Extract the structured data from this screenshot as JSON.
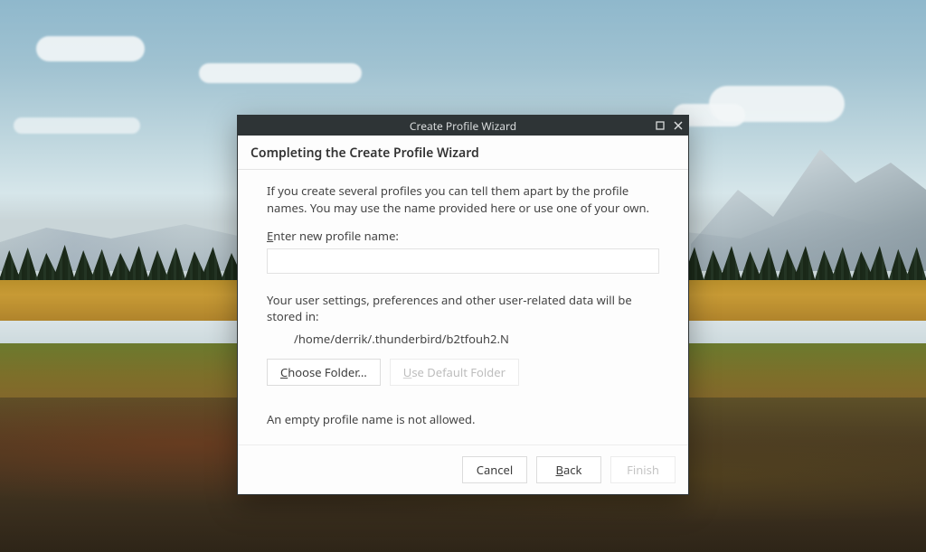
{
  "window": {
    "title": "Create Profile Wizard"
  },
  "heading": "Completing the Create Profile Wizard",
  "intro": "If you create several profiles you can tell them apart by the profile names. You may use the name provided here or use one of your own.",
  "profile_name": {
    "label_prefix": "E",
    "label_rest": "nter new profile name:",
    "value": ""
  },
  "storage": {
    "intro": "Your user settings, preferences and other user-related data will be stored in:",
    "path": "/home/derrik/.thunderbird/b2tfouh2.N"
  },
  "folder_buttons": {
    "choose_prefix": "C",
    "choose_rest": "hoose Folder…",
    "default_prefix": "U",
    "default_rest": "se Default Folder"
  },
  "error": "An empty profile name is not allowed.",
  "footer": {
    "cancel": "Cancel",
    "back_prefix": "B",
    "back_rest": "ack",
    "finish": "Finish"
  }
}
